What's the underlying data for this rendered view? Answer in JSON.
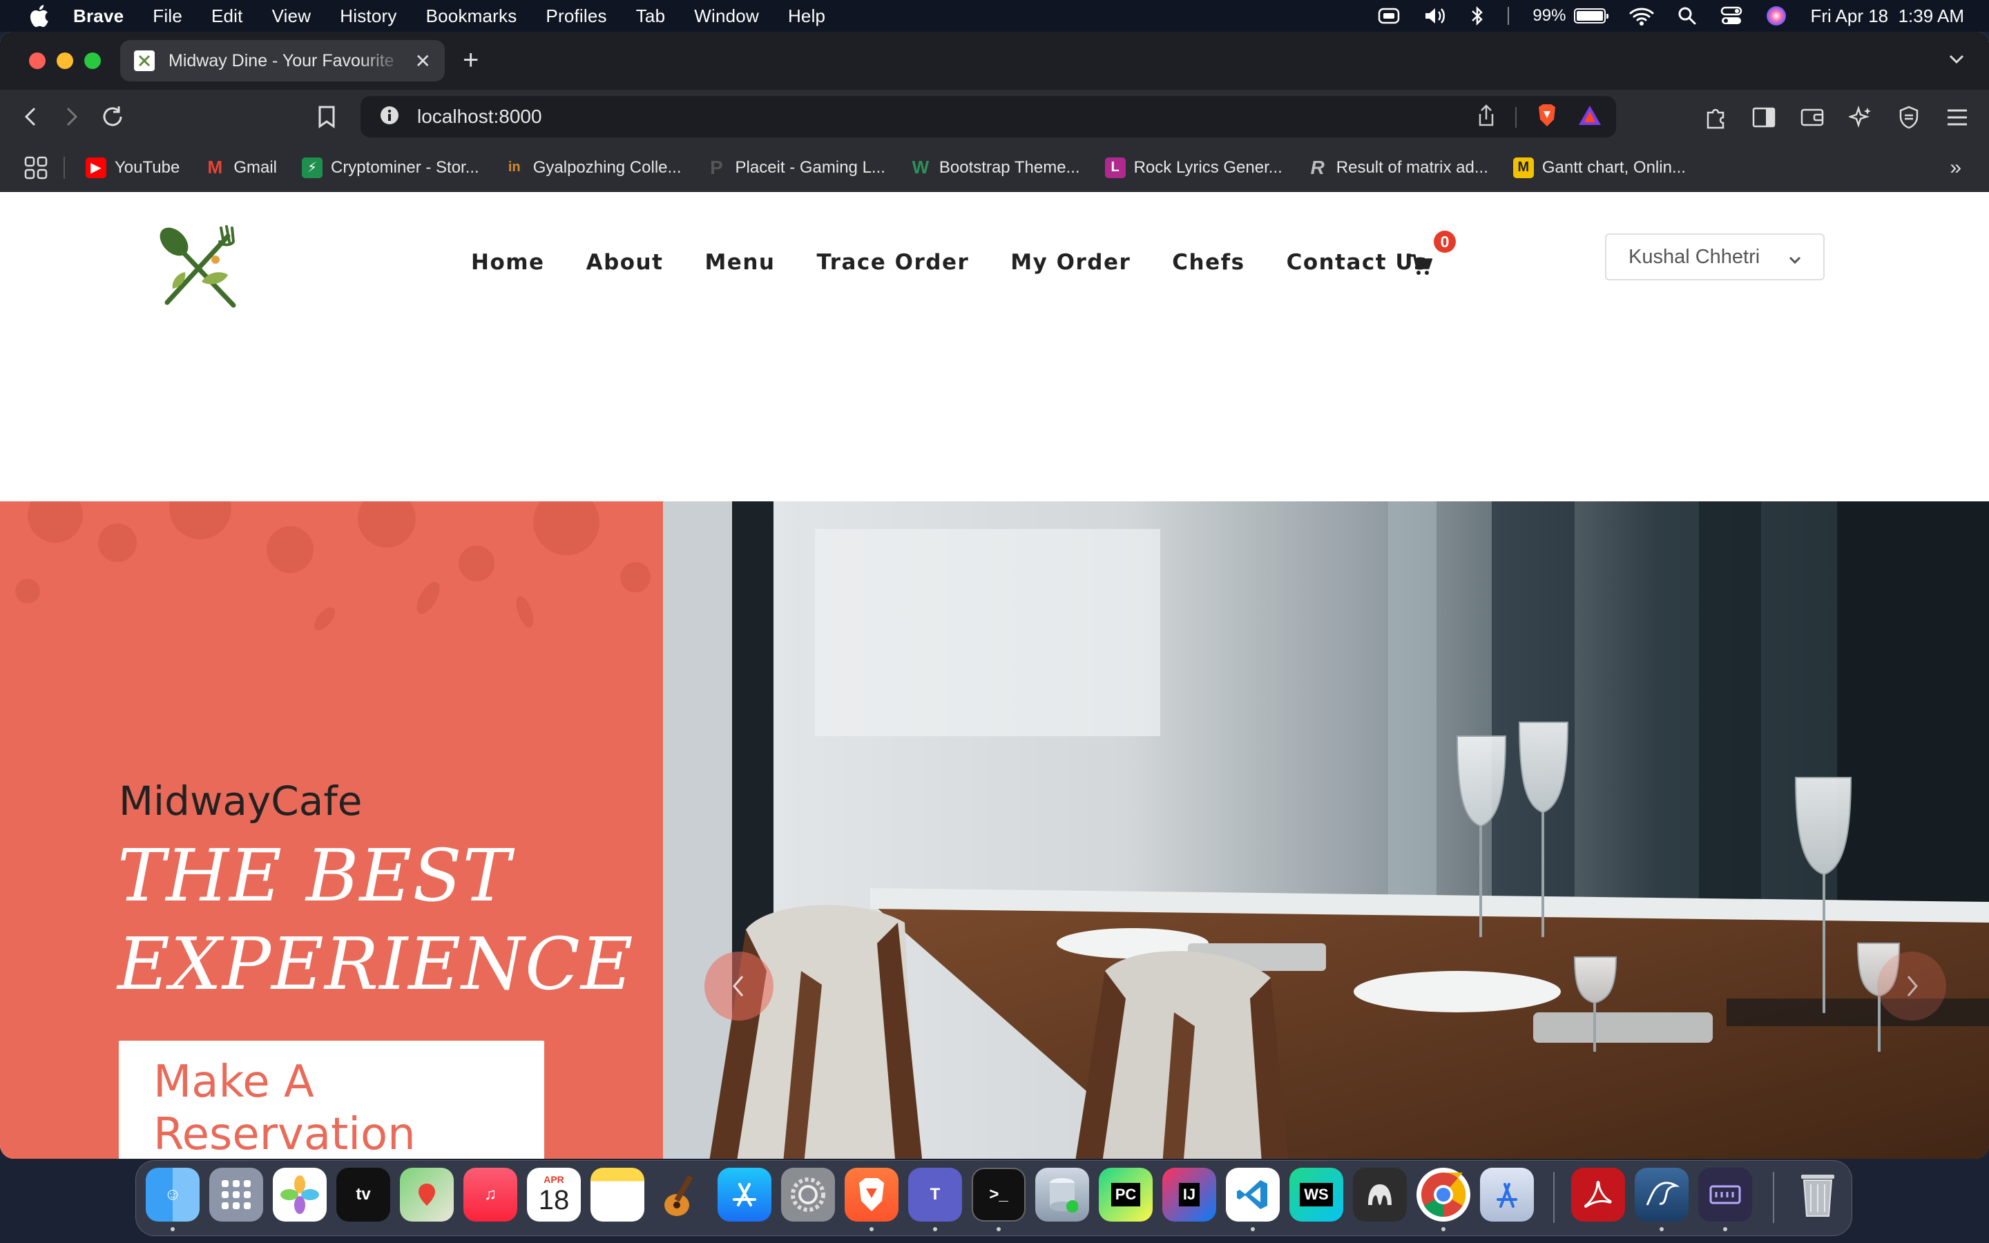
{
  "menubar": {
    "app_name": "Brave",
    "items": [
      "File",
      "Edit",
      "View",
      "History",
      "Bookmarks",
      "Profiles",
      "Tab",
      "Window",
      "Help"
    ],
    "battery_percent": "99%",
    "battery_level": 0.99,
    "datetime": "Fri Apr 18  1:39 AM"
  },
  "browser": {
    "tab_title": "Midway Dine - Your Favourite",
    "url": "localhost:8000",
    "bookmarks": [
      {
        "label": "YouTube",
        "color": "#ff0000"
      },
      {
        "label": "Gmail",
        "color": "#ea4335"
      },
      {
        "label": "Cryptominer - Stor...",
        "color": "#1f8f4e"
      },
      {
        "label": "Gyalpozhing Colle...",
        "color": "#d58b2a"
      },
      {
        "label": "Placeit - Gaming L...",
        "color": "#444444"
      },
      {
        "label": "Bootstrap Theme...",
        "color": "#2f8f5b"
      },
      {
        "label": "Rock Lyrics Gener...",
        "color": "#b0298f"
      },
      {
        "label": "Result of matrix ad...",
        "color": "#777777"
      },
      {
        "label": "Gantt chart, Onlin...",
        "color": "#f2c200"
      }
    ]
  },
  "site": {
    "nav": [
      "Home",
      "About",
      "Menu",
      "Trace Order",
      "My Order",
      "Chefs",
      "Contact Us"
    ],
    "cart_count": "0",
    "user_name": "Kushal Chhetri",
    "hero": {
      "brand": "MidwayCafe",
      "tagline": "THE BEST EXPERIENCE",
      "button": "Make A Reservation"
    },
    "accent_color": "#e96a59"
  },
  "dock": {
    "calendar_month": "APR",
    "calendar_day": "18"
  }
}
